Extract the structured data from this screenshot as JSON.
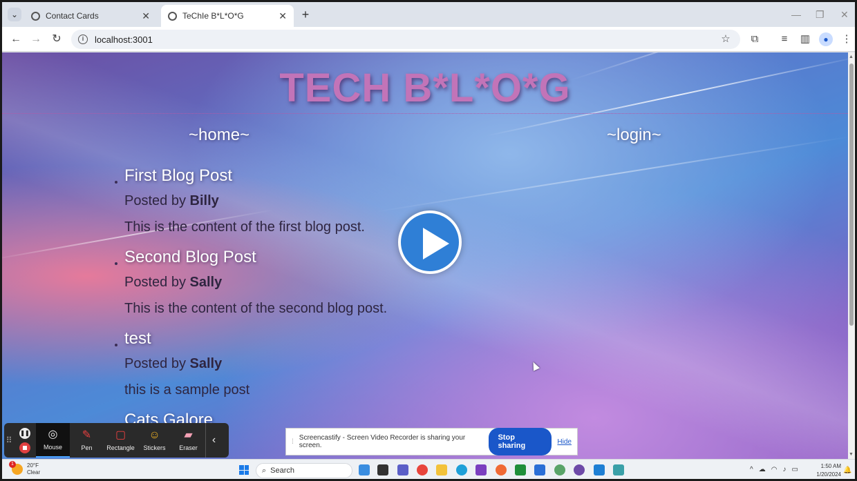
{
  "browser": {
    "tabs": [
      {
        "title": "Contact Cards",
        "close": "✕"
      },
      {
        "title": "TeChIe B*L*O*G",
        "close": "✕"
      }
    ],
    "new_tab": "+",
    "url": "localhost:3001",
    "window_controls": {
      "minimize": "—",
      "restore": "❐",
      "close": "✕"
    }
  },
  "page": {
    "site_title": "TECH B*L*O*G",
    "nav": {
      "home": "~home~",
      "login": "~login~"
    },
    "posts": [
      {
        "title": "First Blog Post",
        "posted_by": "Posted by",
        "author": "Billy",
        "content": "This is the content of the first blog post."
      },
      {
        "title": "Second Blog Post",
        "posted_by": "Posted by",
        "author": "Sally",
        "content": "This is the content of the second blog post."
      },
      {
        "title": "test",
        "posted_by": "Posted by",
        "author": "Sally",
        "content": "this is a sample post"
      },
      {
        "title": "Cats Galore"
      }
    ]
  },
  "screencastify_toolbar": {
    "tools": [
      {
        "label": "Mouse",
        "icon": "mouse-cursor-icon"
      },
      {
        "label": "Pen",
        "icon": "pen-icon"
      },
      {
        "label": "Rectangle",
        "icon": "rectangle-icon"
      },
      {
        "label": "Stickers",
        "icon": "sticker-icon"
      },
      {
        "label": "Eraser",
        "icon": "eraser-icon"
      }
    ]
  },
  "share_banner": {
    "message": "Screencastify - Screen Video Recorder is sharing your screen.",
    "stop_label": "Stop sharing",
    "hide_label": "Hide"
  },
  "taskbar": {
    "weather_temp": "20°F",
    "weather_desc": "Clear",
    "weather_badge": "1",
    "search_label": "Search",
    "time": "1:50 AM",
    "date": "1/20/2024"
  },
  "colors": {
    "title_color": "#c274b8",
    "stop_button": "#1a57c9",
    "play_button": "#2f7fd6"
  }
}
